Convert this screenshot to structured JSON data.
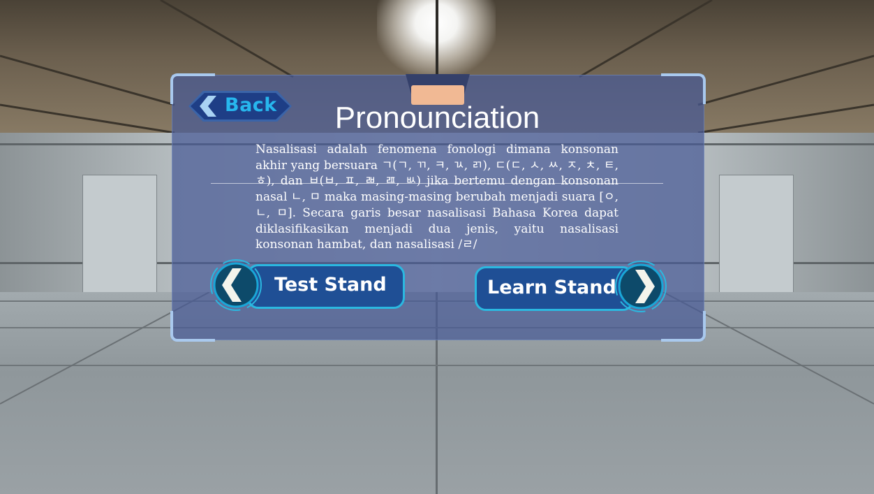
{
  "header": {
    "back_label": "Back",
    "title": "Pronounciation"
  },
  "content": {
    "paragraph": "Nasalisasi adalah fenomena fonologi dimana konsonan akhir yang bersuara ㄱ(ㄱ, ㄲ, ㅋ, ㄳ, ㄺ), ㄷ(ㄷ, ㅅ, ㅆ, ㅈ, ㅊ, ㅌ, ㅎ), dan ㅂ(ㅂ, ㅍ, ㄼ, ㄿ, ㅄ) jika bertemu dengan konsonan nasal ㄴ, ㅁ maka masing-masing berubah menjadi suara [ㅇ, ㄴ, ㅁ]. Secara garis besar nasalisasi Bahasa Korea dapat diklasifikasikan menjadi dua jenis, yaitu nasalisasi konsonan hambat, dan nasalisasi /ㄹ/"
  },
  "navigation": {
    "test_stand_label": "Test Stand",
    "learn_stand_label": "Learn Stand"
  },
  "colors": {
    "panel": "#485a96",
    "frame_accent": "#a9c9ee",
    "button_fill": "#1f4f95",
    "button_border": "#2bb8e0",
    "back_text": "#27b7ee",
    "tab_light": "#f1b994"
  },
  "icons": {
    "back": "chevron-left-icon",
    "test_stand": "chevron-left-icon",
    "learn_stand": "chevron-right-icon"
  }
}
